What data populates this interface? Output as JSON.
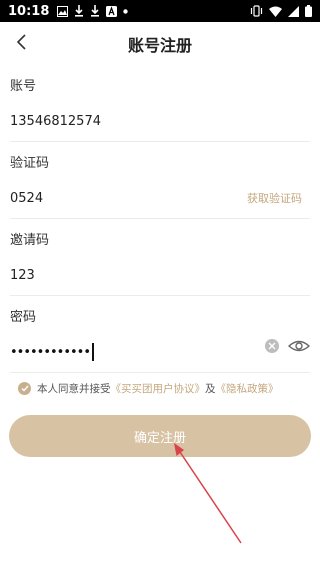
{
  "status_bar": {
    "time": "10:18",
    "icons_left": [
      "image-icon",
      "download-icon",
      "download-icon",
      "a-box-icon",
      "dot-icon"
    ],
    "icons_right": [
      "vibrate-icon",
      "wifi-icon",
      "signal-icon",
      "battery-icon"
    ]
  },
  "header": {
    "title": "账号注册",
    "back_icon": "chevron-left-icon"
  },
  "form": {
    "account": {
      "label": "账号",
      "value": "13546812574"
    },
    "code": {
      "label": "验证码",
      "value": "0524",
      "get_code_label": "获取验证码"
    },
    "invite": {
      "label": "邀请码",
      "value": "123"
    },
    "password": {
      "label": "密码",
      "masked_value": "••••••••••••"
    }
  },
  "agreement": {
    "prefix": "本人同意并接受",
    "user_agreement": "《买买团用户协议》",
    "and": "及",
    "privacy_policy": "《隐私政策》",
    "checked": true
  },
  "submit": {
    "label": "确定注册"
  },
  "colors": {
    "accent": "#c4a77d",
    "button": "#d7c3a4",
    "annotation_arrow": "#d9434a"
  }
}
